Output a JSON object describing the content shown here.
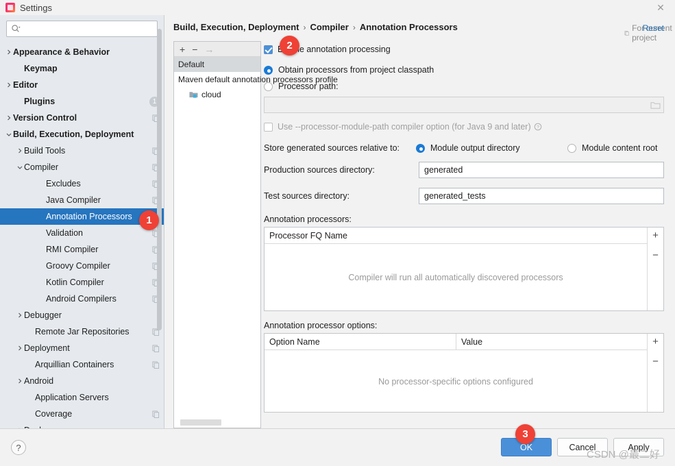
{
  "window": {
    "title": "Settings",
    "app_icon": "intellij-idea-icon",
    "close_icon": "close-icon"
  },
  "search": {
    "icon": "search-icon",
    "value": "",
    "placeholder": ""
  },
  "sidebar": {
    "items": [
      {
        "label": "Appearance & Behavior",
        "arrow": "chevron-right",
        "indent": 0,
        "bold": true,
        "selected": false,
        "badge": "",
        "copy": false
      },
      {
        "label": "Keymap",
        "arrow": "",
        "indent": 1,
        "bold": true,
        "selected": false,
        "badge": "",
        "copy": false
      },
      {
        "label": "Editor",
        "arrow": "chevron-right",
        "indent": 0,
        "bold": true,
        "selected": false,
        "badge": "",
        "copy": false
      },
      {
        "label": "Plugins",
        "arrow": "",
        "indent": 1,
        "bold": true,
        "selected": false,
        "badge": "1",
        "copy": false
      },
      {
        "label": "Version Control",
        "arrow": "chevron-right",
        "indent": 0,
        "bold": true,
        "selected": false,
        "badge": "",
        "copy": true
      },
      {
        "label": "Build, Execution, Deployment",
        "arrow": "chevron-down",
        "indent": 0,
        "bold": true,
        "selected": false,
        "badge": "",
        "copy": false
      },
      {
        "label": "Build Tools",
        "arrow": "chevron-right",
        "indent": 1,
        "bold": false,
        "selected": false,
        "badge": "",
        "copy": true
      },
      {
        "label": "Compiler",
        "arrow": "chevron-down",
        "indent": 1,
        "bold": false,
        "selected": false,
        "badge": "",
        "copy": true
      },
      {
        "label": "Excludes",
        "arrow": "",
        "indent": 3,
        "bold": false,
        "selected": false,
        "badge": "",
        "copy": true
      },
      {
        "label": "Java Compiler",
        "arrow": "",
        "indent": 3,
        "bold": false,
        "selected": false,
        "badge": "",
        "copy": true
      },
      {
        "label": "Annotation Processors",
        "arrow": "",
        "indent": 3,
        "bold": false,
        "selected": true,
        "badge": "",
        "copy": true
      },
      {
        "label": "Validation",
        "arrow": "",
        "indent": 3,
        "bold": false,
        "selected": false,
        "badge": "",
        "copy": true
      },
      {
        "label": "RMI Compiler",
        "arrow": "",
        "indent": 3,
        "bold": false,
        "selected": false,
        "badge": "",
        "copy": true
      },
      {
        "label": "Groovy Compiler",
        "arrow": "",
        "indent": 3,
        "bold": false,
        "selected": false,
        "badge": "",
        "copy": true
      },
      {
        "label": "Kotlin Compiler",
        "arrow": "",
        "indent": 3,
        "bold": false,
        "selected": false,
        "badge": "",
        "copy": true
      },
      {
        "label": "Android Compilers",
        "arrow": "",
        "indent": 3,
        "bold": false,
        "selected": false,
        "badge": "",
        "copy": true
      },
      {
        "label": "Debugger",
        "arrow": "chevron-right",
        "indent": 1,
        "bold": false,
        "selected": false,
        "badge": "",
        "copy": false
      },
      {
        "label": "Remote Jar Repositories",
        "arrow": "",
        "indent": 2,
        "bold": false,
        "selected": false,
        "badge": "",
        "copy": true
      },
      {
        "label": "Deployment",
        "arrow": "chevron-right",
        "indent": 1,
        "bold": false,
        "selected": false,
        "badge": "",
        "copy": true
      },
      {
        "label": "Arquillian Containers",
        "arrow": "",
        "indent": 2,
        "bold": false,
        "selected": false,
        "badge": "",
        "copy": true
      },
      {
        "label": "Android",
        "arrow": "chevron-right",
        "indent": 1,
        "bold": false,
        "selected": false,
        "badge": "",
        "copy": false
      },
      {
        "label": "Application Servers",
        "arrow": "",
        "indent": 2,
        "bold": false,
        "selected": false,
        "badge": "",
        "copy": false
      },
      {
        "label": "Coverage",
        "arrow": "",
        "indent": 2,
        "bold": false,
        "selected": false,
        "badge": "",
        "copy": true
      },
      {
        "label": "Docker",
        "arrow": "chevron-right",
        "indent": 1,
        "bold": false,
        "selected": false,
        "badge": "",
        "copy": false
      }
    ]
  },
  "header": {
    "breadcrumb": [
      "Build, Execution, Deployment",
      "Compiler",
      "Annotation Processors"
    ],
    "separator": "›",
    "scope_label": "For current project",
    "scope_icon": "project-scope-icon",
    "reset_label": "Reset"
  },
  "modules": {
    "toolbar": {
      "add": "+",
      "remove": "−",
      "move": "→"
    },
    "rows": [
      {
        "label": "Default",
        "selected": true,
        "indent": false,
        "icon": ""
      },
      {
        "label": "Maven default annotation processors profile",
        "selected": false,
        "indent": false,
        "icon": ""
      },
      {
        "label": "cloud",
        "selected": false,
        "indent": true,
        "icon": "module-icon"
      }
    ]
  },
  "form": {
    "enable_processing": {
      "label": "Enable annotation processing",
      "checked": true
    },
    "source_group": {
      "obtain_classpath": {
        "label": "Obtain processors from project classpath",
        "selected": true
      },
      "processor_path": {
        "label": "Processor path:",
        "selected": false
      },
      "processor_path_value": "",
      "browse_icon": "folder-browse-icon"
    },
    "module_path_option": {
      "label": "Use --processor-module-path compiler option (for Java 9 and later)",
      "checked": false,
      "disabled": true,
      "help_icon": "help-circle-icon"
    },
    "store_relative": {
      "label": "Store generated sources relative to:",
      "option_output": {
        "label": "Module output directory",
        "selected": true
      },
      "option_content": {
        "label": "Module content root",
        "selected": false
      }
    },
    "production_dir": {
      "label": "Production sources directory:",
      "value": "generated"
    },
    "test_dir": {
      "label": "Test sources directory:",
      "value": "generated_tests"
    },
    "processors_table": {
      "label": "Annotation processors:",
      "columns": [
        "Processor FQ Name"
      ],
      "rows": [],
      "empty_text": "Compiler will run all automatically discovered processors",
      "add_icon": "+",
      "remove_icon": "−"
    },
    "options_table": {
      "label": "Annotation processor options:",
      "columns": [
        "Option Name",
        "Value"
      ],
      "rows": [],
      "empty_text": "No processor-specific options configured",
      "add_icon": "+",
      "remove_icon": "−"
    }
  },
  "footer": {
    "help_icon": "?",
    "ok_label": "OK",
    "cancel_label": "Cancel",
    "apply_label": "Apply"
  },
  "annotations": {
    "badge_1": "1",
    "badge_2": "2",
    "badge_3": "3"
  },
  "watermark": {
    "text": "CSDN @最二好"
  },
  "colors": {
    "accent": "#4a90d9",
    "selection": "#2675bf",
    "link": "#2470b3",
    "badge": "#ef4136",
    "sidebar_bg": "#e6eaee"
  }
}
